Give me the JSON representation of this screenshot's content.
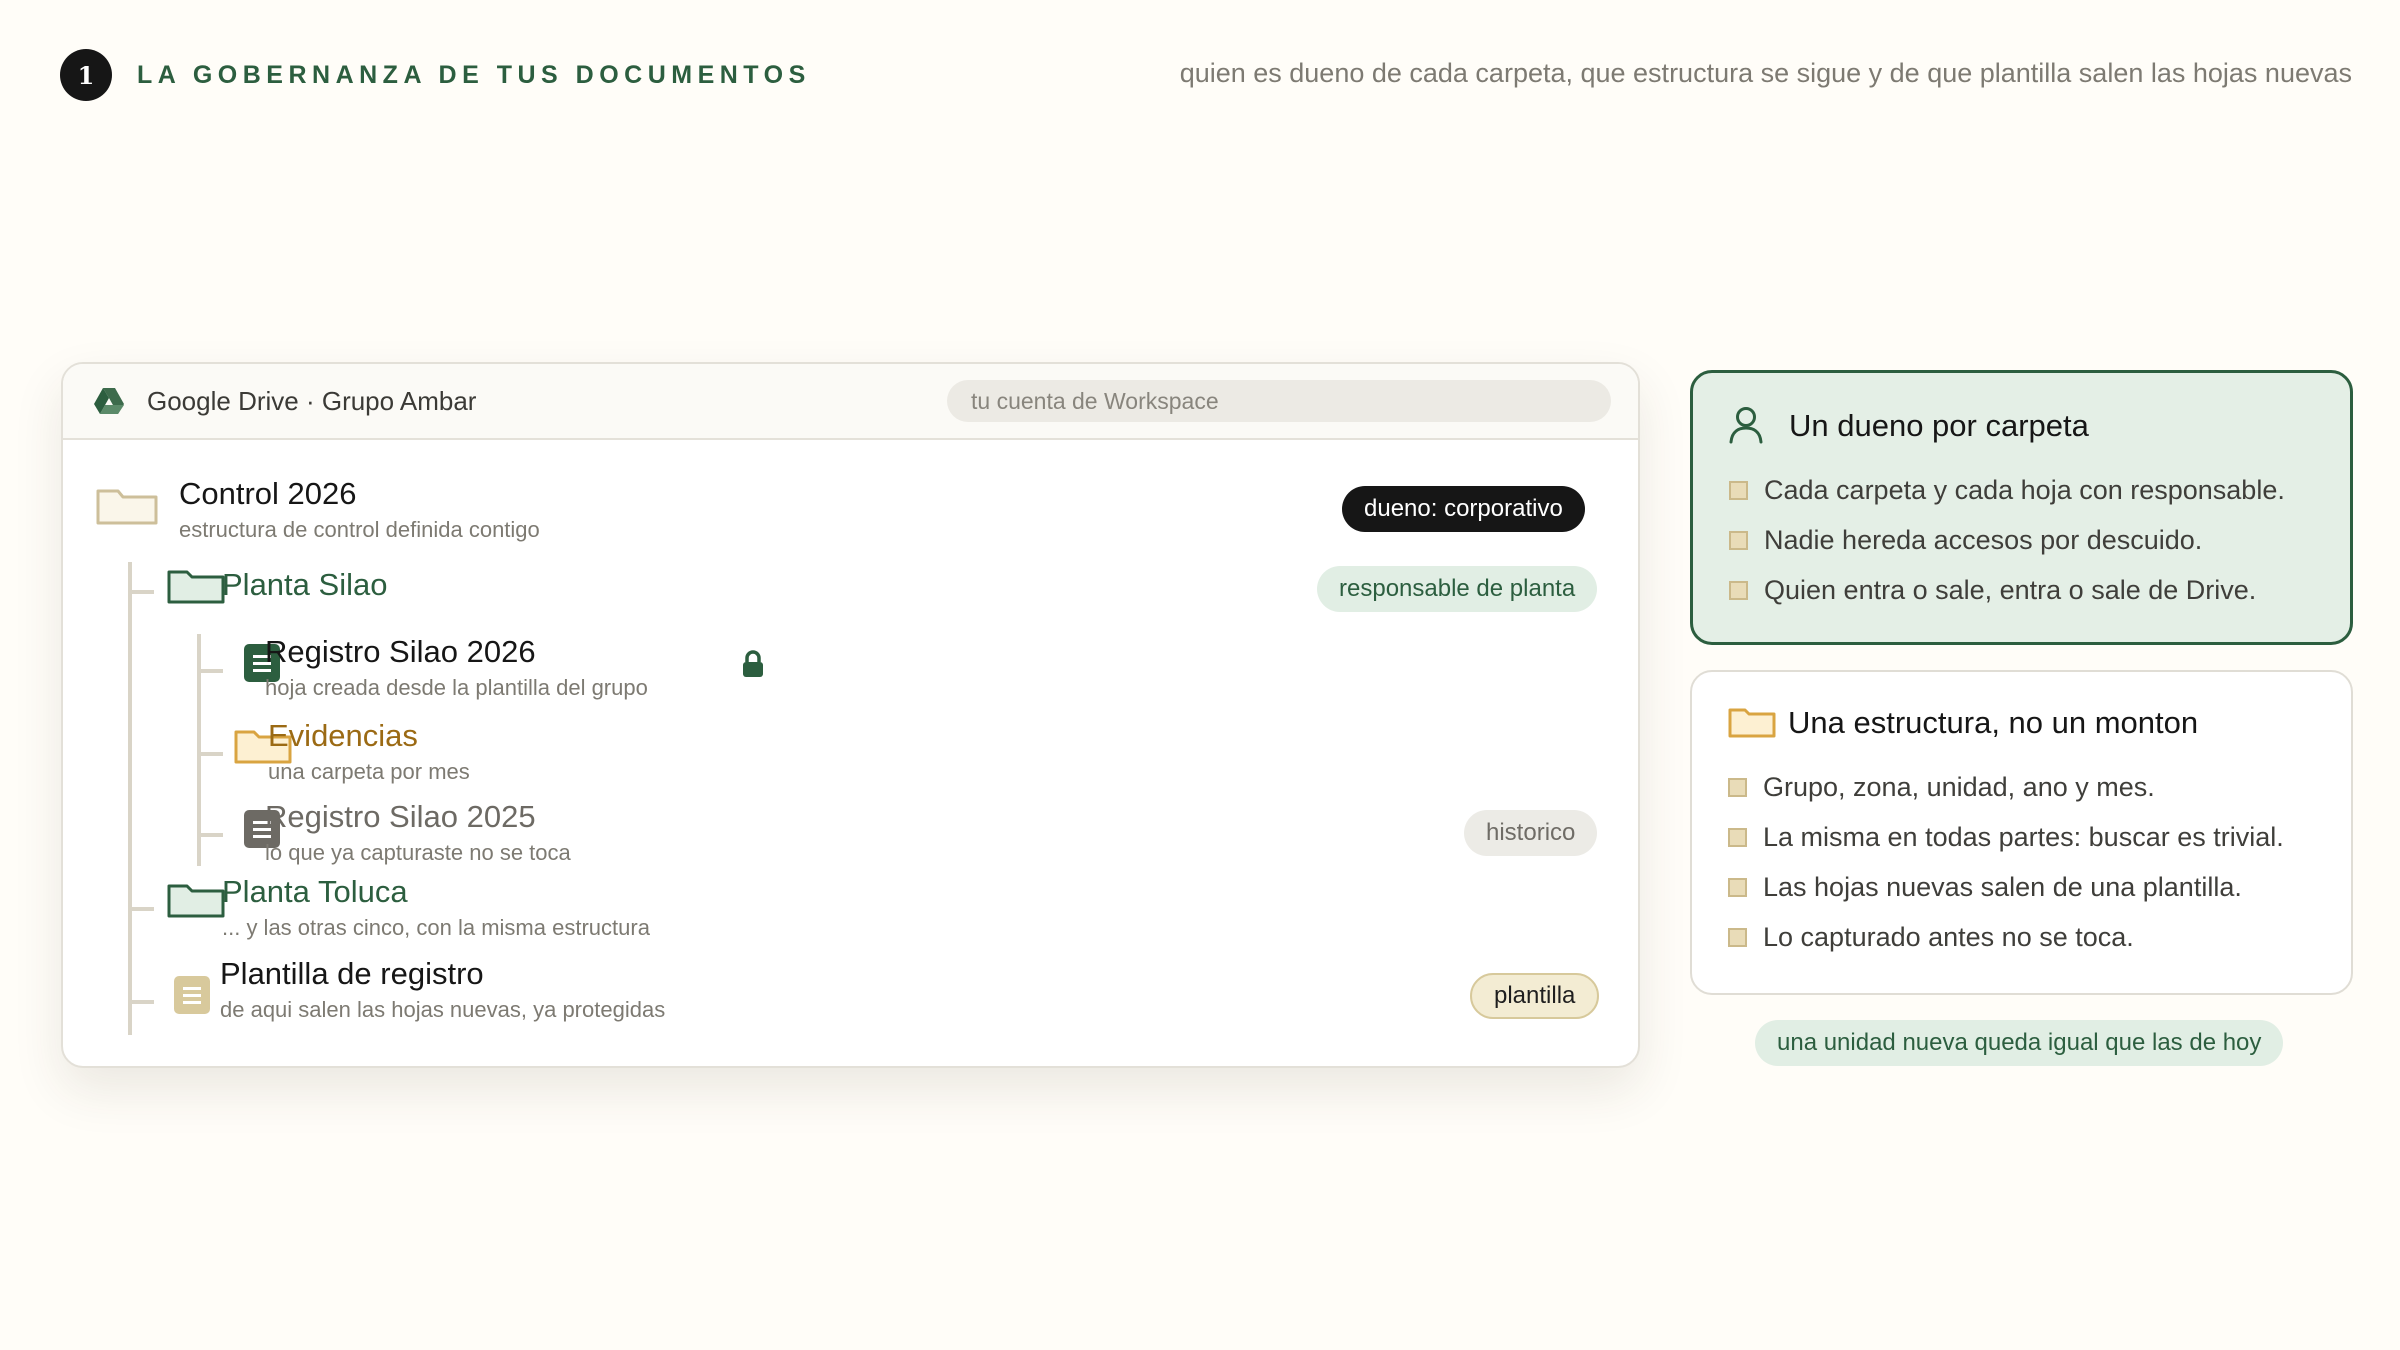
{
  "header": {
    "step": "1",
    "title": "LA GOBERNANZA DE TUS DOCUMENTOS",
    "subtitle": "quien es dueno de cada carpeta, que estructura se sigue y de que plantilla salen las hojas nuevas"
  },
  "drive": {
    "app_name": "Google Drive · Grupo Ambar",
    "search_placeholder": "tu cuenta de Workspace",
    "items": [
      {
        "icon": "folder-icon",
        "title": "Control 2026",
        "subtitle": "estructura de control definida contigo",
        "badge": "dueno: corporativo"
      },
      {
        "icon": "folder-icon",
        "title": "Planta Silao",
        "badge": "responsable de planta"
      },
      {
        "icon": "sheet-icon",
        "title": "Registro Silao 2026",
        "subtitle": "hoja creada desde la plantilla del grupo",
        "lock_icon": "lock-icon"
      },
      {
        "icon": "folder-icon",
        "title": "Evidencias",
        "subtitle": "una carpeta por mes"
      },
      {
        "icon": "sheet-icon",
        "title": "Registro Silao 2025",
        "subtitle": "lo que ya capturaste no se toca",
        "badge": "historico"
      },
      {
        "icon": "folder-icon",
        "title": "Planta Toluca",
        "subtitle": "... y las otras cinco, con la misma estructura"
      },
      {
        "icon": "template-icon",
        "title": "Plantilla de registro",
        "subtitle": "de aqui salen las hojas nuevas, ya protegidas",
        "badge": "plantilla"
      }
    ]
  },
  "cards": [
    {
      "icon": "person-icon",
      "title": "Un dueno por carpeta",
      "items": [
        "Cada carpeta y cada hoja con responsable.",
        "Nadie hereda accesos por descuido.",
        "Quien entra o sale, entra o sale de Drive."
      ]
    },
    {
      "icon": "folder-icon",
      "title": "Una estructura, no un monton",
      "items": [
        "Grupo, zona, unidad, ano y mes.",
        "La misma en todas partes: buscar es trivial.",
        "Las hojas nuevas salen de una plantilla.",
        "Lo capturado antes no se toca."
      ]
    }
  ],
  "footnote": "una unidad nueva queda igual que las de hoy",
  "colors": {
    "accent_green": "#2c5e3f",
    "accent_amber": "#9b6a14",
    "mint": "#e4efe6",
    "background": "#fffdf8"
  }
}
